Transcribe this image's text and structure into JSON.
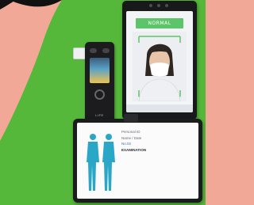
{
  "colors": {
    "background_green": "#56b83a",
    "background_salmon": "#f2a896",
    "device_dark": "#18191b",
    "screen_banner": "#5cc56a",
    "body_silhouette": "#2aa7c7"
  },
  "terminal": {
    "banner_text": "NORMAL"
  },
  "breathalyzer": {
    "logo": "LIFE"
  },
  "tablet": {
    "info_lines": [
      "Personal ID",
      "Name / Date",
      "No.02",
      "EXAMINATION"
    ]
  },
  "icons": [
    "breathalyzer-device",
    "face-recognition-terminal",
    "tablet-display",
    "body-silhouette-icon"
  ]
}
